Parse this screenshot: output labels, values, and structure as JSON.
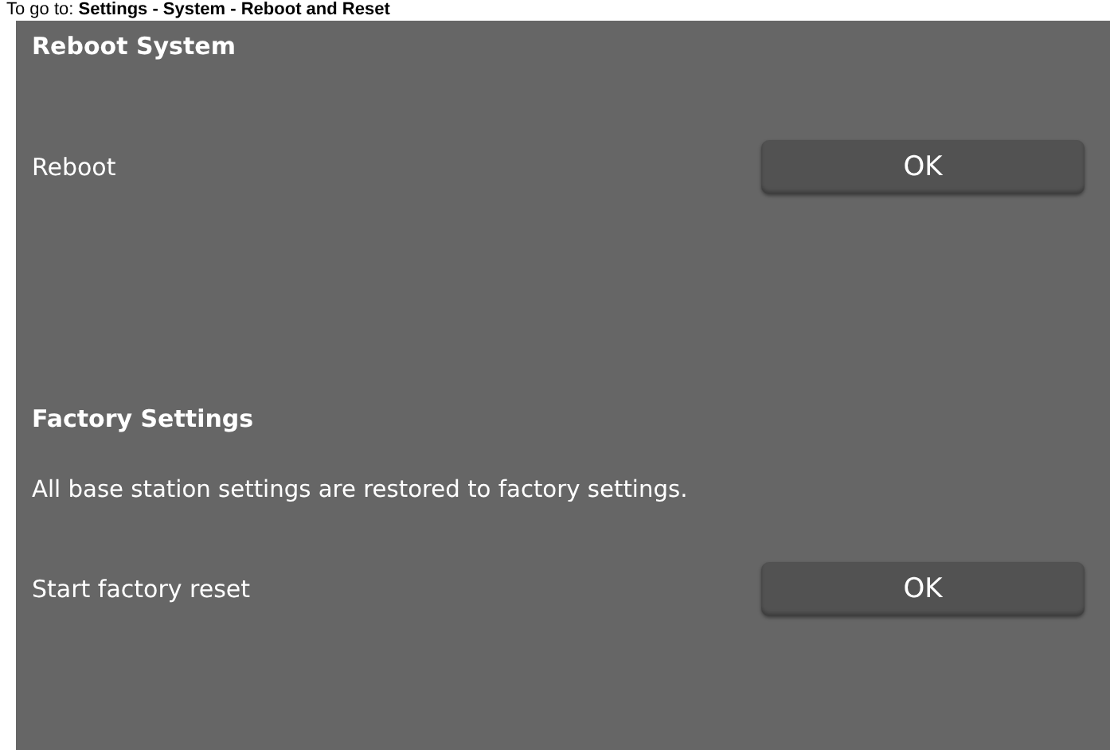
{
  "caption": "To go to: **Settings - System - Reboot and Reset**",
  "sections": [
    {
      "title": "Reboot System",
      "rows": [
        {
          "kind": "action",
          "label": "Reboot",
          "button": "OK"
        }
      ]
    },
    {
      "title": "Factory Settings",
      "rows": [
        {
          "kind": "text",
          "text": "All base station settings are restored to factory settings."
        },
        {
          "kind": "action",
          "label": "Start factory reset",
          "button": "OK"
        }
      ]
    }
  ]
}
